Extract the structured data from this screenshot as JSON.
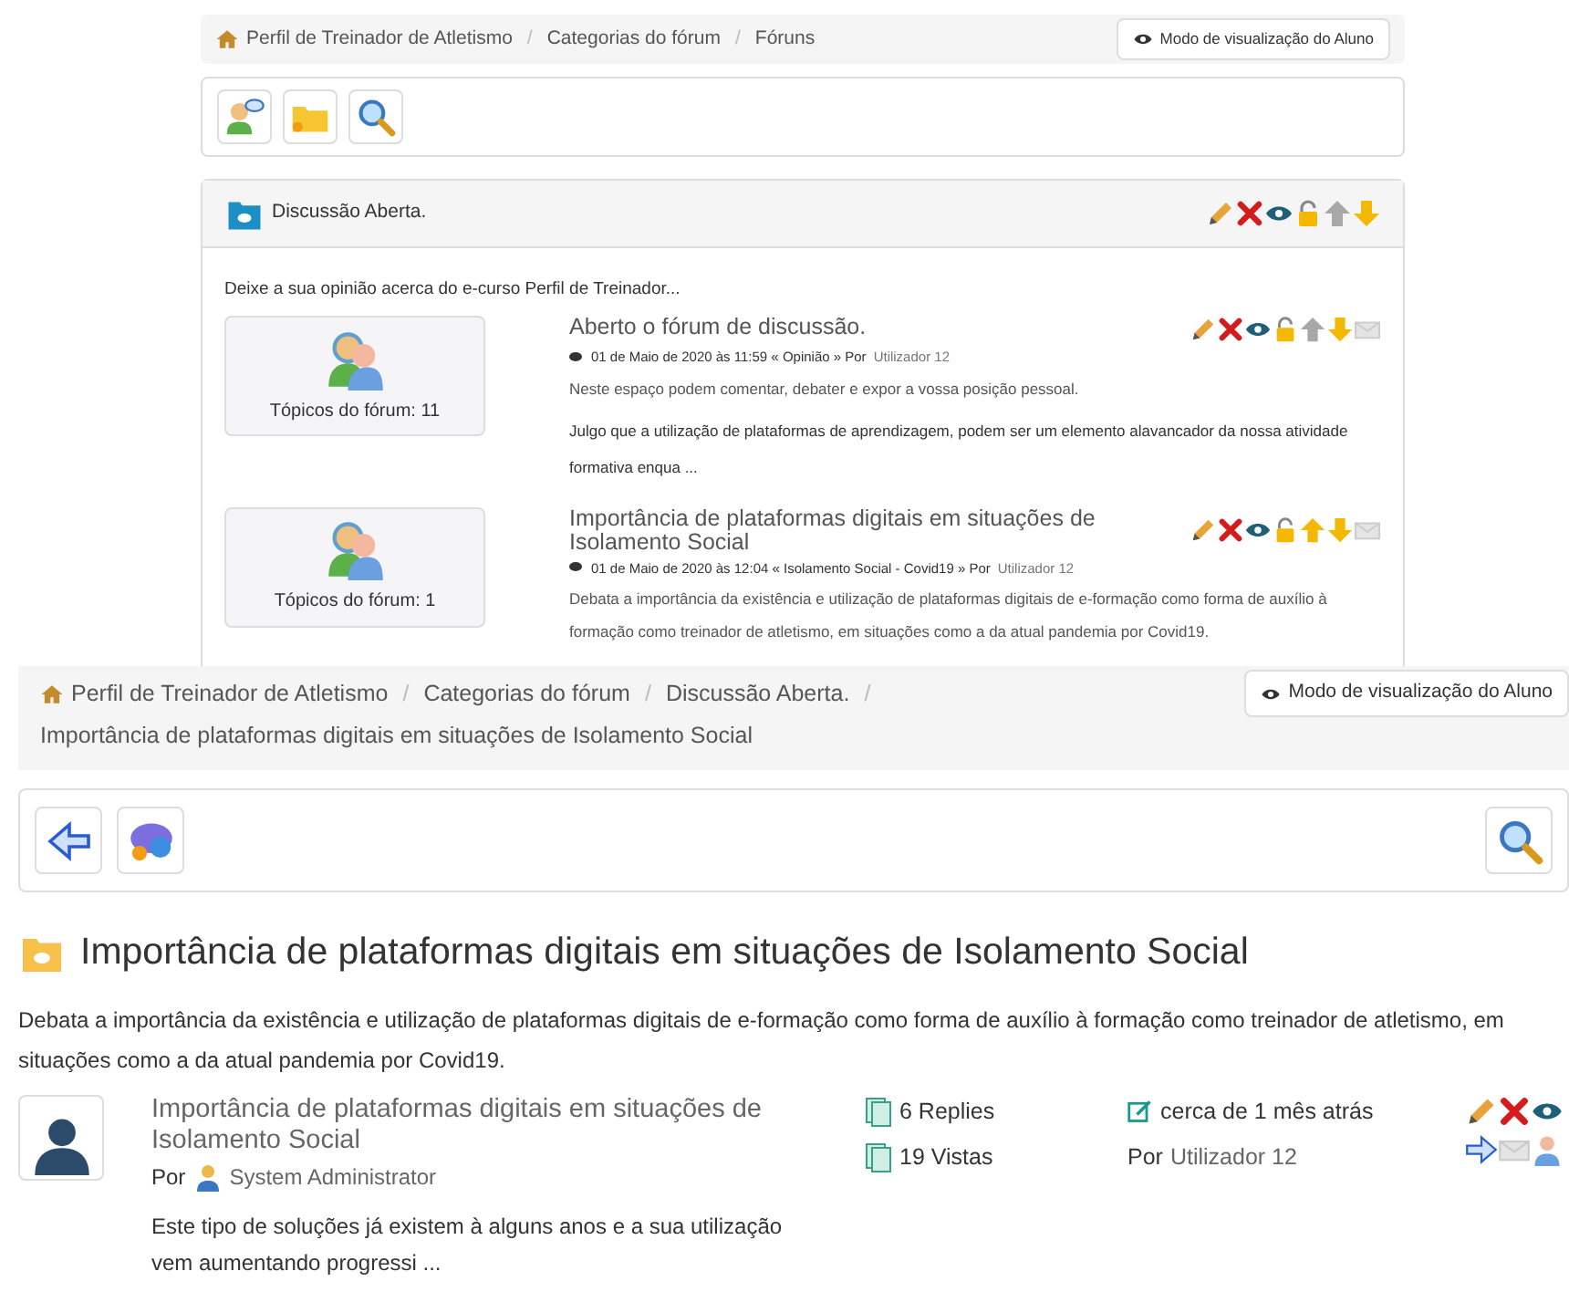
{
  "top_view": {
    "breadcrumb_separator": "/",
    "breadcrumb": [
      "Perfil de Treinador de Atletismo",
      "Categorias do fórum",
      "Fóruns"
    ],
    "student_view_button": "Modo de visualização do Aluno",
    "category": {
      "title": "Discussão Aberta.",
      "description": "Deixe a sua opinião acerca do e-curso Perfil de Treinador...",
      "forums": [
        {
          "topics": "Tópicos do fórum: 11",
          "title": "Aberto o fórum de discussão.",
          "meta": "01 de Maio de 2020 às 11:59 « Opinião » Por",
          "author": "Utilizador 12",
          "description": "Neste espaço podem comentar, debater e expor a vossa posição pessoal.",
          "excerpt": "Julgo que a utilização de plataformas de aprendizagem, podem ser um elemento alavancador da nossa atividade formativa enqua ...",
          "can_move_up": false
        },
        {
          "topics": "Tópicos do fórum: 1",
          "title": "Importância de plataformas digitais em situações de Isolamento Social",
          "meta": "01 de Maio de 2020 às 12:04 « Isolamento Social - Covid19 » Por",
          "author": "Utilizador 12",
          "description": "Debata a importância da existência e utilização de plataformas digitais de e-formação como forma de auxílio à formação como treinador de atletismo, em situações como a da atual pandemia por Covid19.",
          "can_move_up": true
        }
      ]
    }
  },
  "bottom_view": {
    "breadcrumb_separator": "/",
    "breadcrumb": [
      "Perfil de Treinador de Atletismo",
      "Categorias do fórum",
      "Discussão Aberta.",
      "Importância de plataformas digitais em situações de Isolamento Social"
    ],
    "student_view_button": "Modo de visualização do Aluno",
    "forum": {
      "title": "Importância de plataformas digitais em situações de Isolamento Social",
      "description": "Debata a importância da existência e utilização de plataformas digitais de e-formação como forma de auxílio à formação como treinador de atletismo, em situações como a da atual pandemia por Covid19.",
      "topics": [
        {
          "title": "Importância de plataformas digitais em situações de Isolamento Social",
          "by": "Por",
          "author": "System Administrator",
          "excerpt": "Este tipo de soluções já existem à alguns anos e a sua utilização vem aumentando progressi ...",
          "replies": "6 Replies",
          "views": "19 Vistas",
          "time_ago": "cerca de 1 mês atrás",
          "last_by": "Por",
          "last_author": "Utilizador 12"
        }
      ]
    }
  }
}
